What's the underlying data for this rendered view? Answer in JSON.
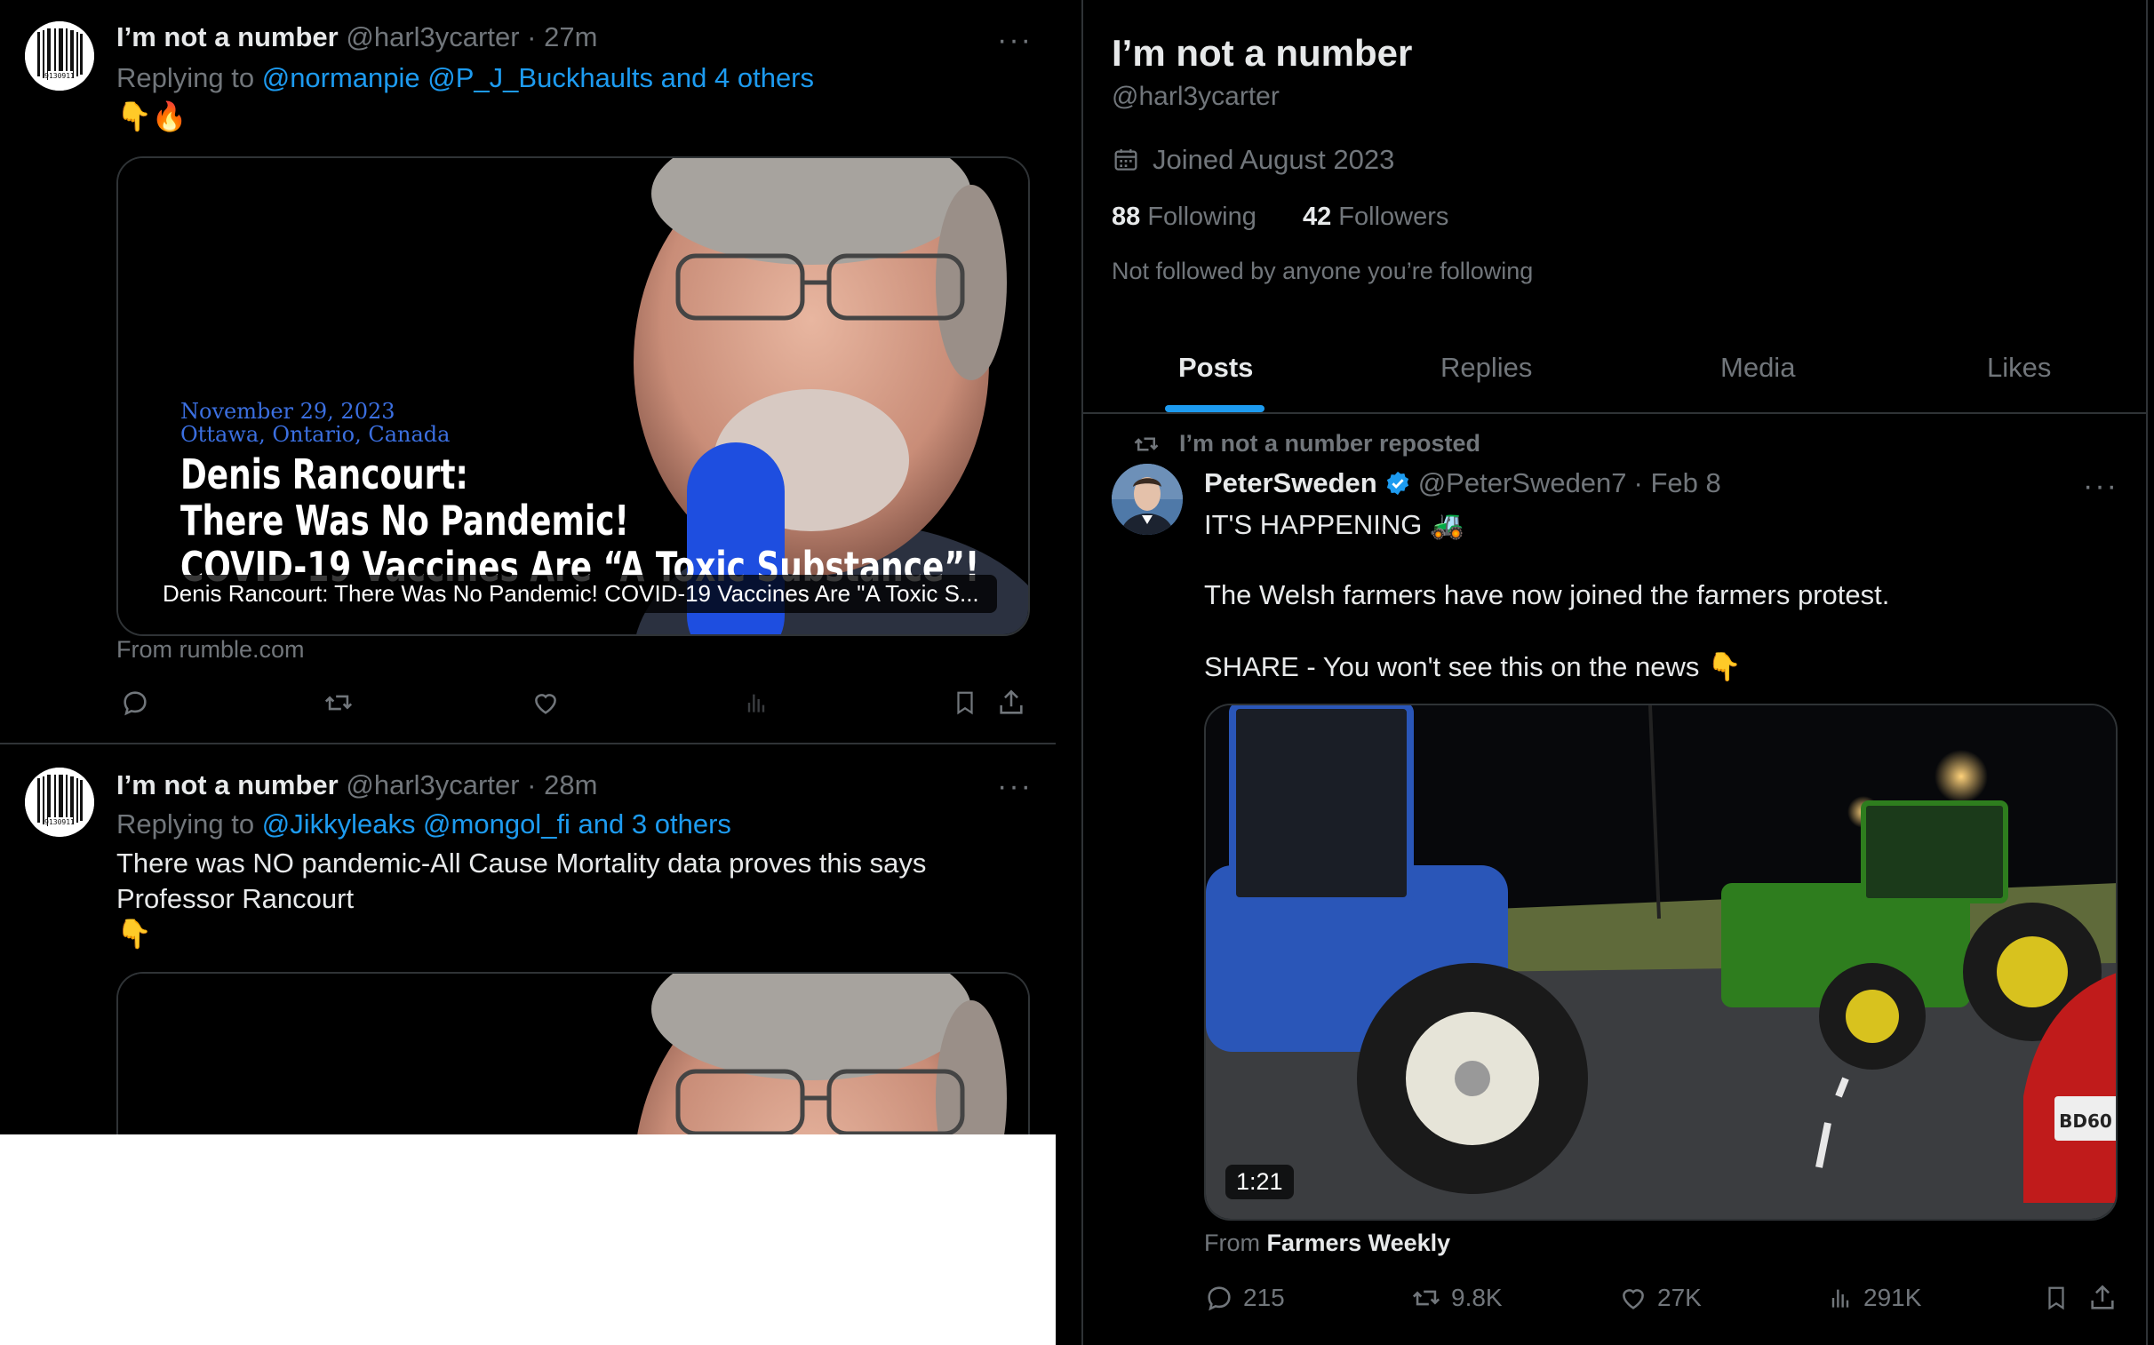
{
  "left_panel": {
    "tweet1": {
      "author_name": "I’m not a number",
      "handle": "@harl3ycarter",
      "time": "· 27m",
      "replying_prefix": "Replying to",
      "replying_to": "@normanpie @P_J_Buckhaults and 4 others",
      "emojis": "👇🔥",
      "card": {
        "date_line": "November 29, 2023",
        "location_line": "Ottawa, Ontario, Canada",
        "headline_1": "Denis Rancourt:",
        "headline_2": "There Was No Pandemic!",
        "headline_3": "COVID-19 Vaccines Are “A Toxic Substance”!",
        "overlay_title": "Denis Rancourt: There Was No Pandemic! COVID-19 Vaccines Are \"A Toxic S...",
        "source": "From rumble.com"
      }
    },
    "tweet2": {
      "author_name": "I’m not a number",
      "handle": "@harl3ycarter",
      "time": "· 28m",
      "replying_prefix": "Replying to",
      "replying_to": "@Jikkyleaks @mongol_fi and 3 others",
      "text_line1": "There was NO pandemic-All Cause Mortality data proves this says",
      "text_line2": "Professor Rancourt",
      "emoji": "👇"
    },
    "more_glyph": "···"
  },
  "right_panel": {
    "profile_name": "I’m not a number",
    "profile_handle": "@harl3ycarter",
    "joined": "Joined August 2023",
    "following_count": "88",
    "following_label": "Following",
    "followers_count": "42",
    "followers_label": "Followers",
    "not_followed": "Not followed by anyone you’re following",
    "tabs": [
      "Posts",
      "Replies",
      "Media",
      "Likes"
    ],
    "reposted_by": "I’m not a number reposted",
    "post": {
      "author_name": "PeterSweden",
      "handle": "@PeterSweden7",
      "date": "· Feb 8",
      "line1": "IT'S HAPPENING 🚜",
      "line2": "The Welsh farmers have now joined the farmers protest.",
      "line3": "SHARE - You won't see this on the news 👇",
      "video_duration": "1:21",
      "source_prefix": "From",
      "source_name": "Farmers Weekly",
      "replies": "215",
      "reposts": "9.8K",
      "likes": "27K",
      "views": "291K",
      "plate_text": "BD60"
    }
  },
  "colors": {
    "background": "#000000",
    "text_primary": "#e7e9ea",
    "text_muted": "#71767b",
    "link": "#1d9bf0",
    "border": "#2f3336",
    "card_date_color": "#3b6fe0"
  }
}
